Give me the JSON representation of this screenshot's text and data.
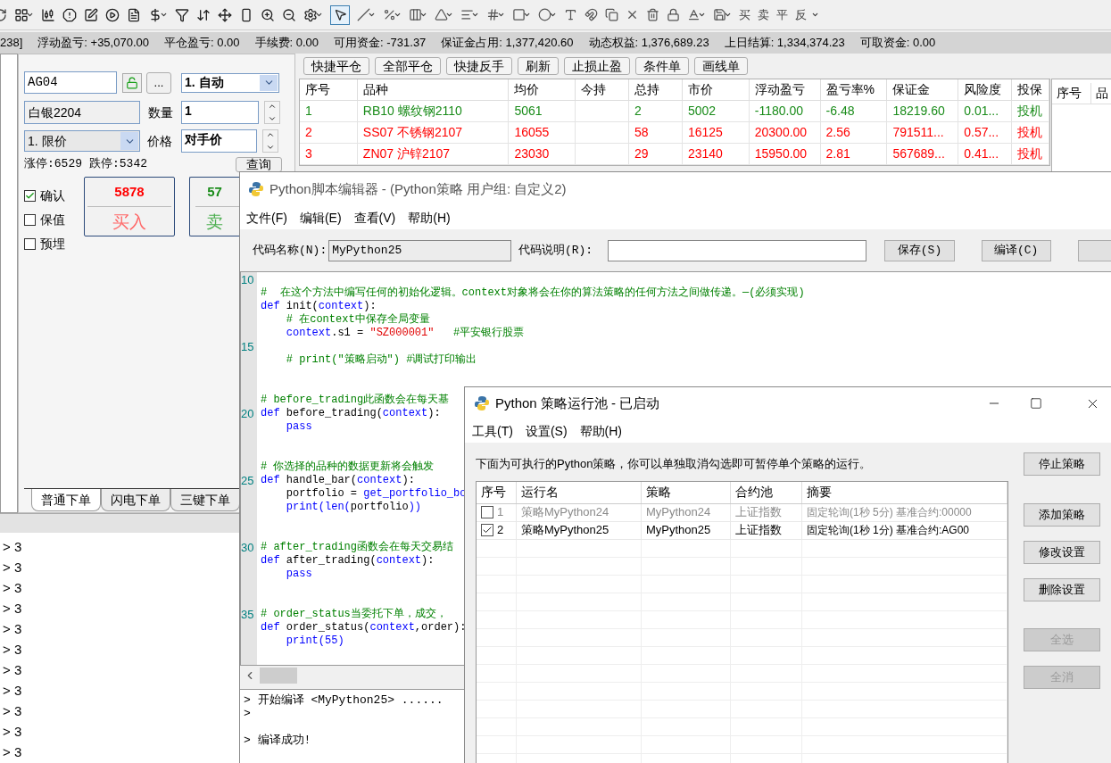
{
  "toolbar": {
    "pointer_tool_selected": true,
    "text_tools": [
      "买",
      "卖",
      "平",
      "反"
    ]
  },
  "status_bar": [
    "238]",
    "浮动盈亏: +35,070.00",
    "平仓盈亏: 0.00",
    "手续费: 0.00",
    "可用资金: -731.37",
    "保证金占用: 1,377,420.60",
    "动态权益: 1,376,689.23",
    "上日结算: 1,334,374.23",
    "可取资金: 0.00"
  ],
  "order_form": {
    "code": "AG04",
    "more_button": "...",
    "mode": "1. 自动",
    "contract": "白银2204",
    "quantity_label": "数量",
    "quantity": "1",
    "price_type": "1. 限价",
    "price_label": "价格",
    "price": "对手价",
    "limit_up": "涨停:6529",
    "limit_down": "跌停:5342",
    "query_button": "查询",
    "options": [
      {
        "label": "确认",
        "checked": true
      },
      {
        "label": "保值",
        "checked": false
      },
      {
        "label": "预埋",
        "checked": false
      }
    ],
    "buy": {
      "price": "5878",
      "label": "买入"
    },
    "sell": {
      "price": "57",
      "label": "卖"
    },
    "tabs": [
      {
        "label": "普通下单",
        "selected": true
      },
      {
        "label": "闪电下单",
        "selected": false
      },
      {
        "label": "三键下单",
        "selected": false
      }
    ]
  },
  "log": {
    "lines": [
      "> 3",
      "> 3",
      "> 3",
      "> 3",
      "> 3",
      "> 3",
      "> 3",
      "> 3",
      "> 3",
      "> 3",
      "> 3"
    ]
  },
  "positions": {
    "buttons": [
      "快捷平仓",
      "全部平仓",
      "快捷反手",
      "刷新",
      "止损止盈",
      "条件单",
      "画线单"
    ],
    "columns": [
      "序号",
      "品种",
      "均价",
      "今持",
      "总持",
      "市价",
      "浮动盈亏",
      "盈亏率%",
      "保证金",
      "风险度",
      "投保"
    ],
    "rows": [
      {
        "color": "#1a8c1a",
        "cells": [
          "1",
          "RB10 螺纹钢2110",
          "5061",
          null,
          "2",
          "5002",
          "-1180.00",
          "-6.48",
          "18219.60",
          "0.01...",
          "投机"
        ]
      },
      {
        "color": "#ff0000",
        "cells": [
          "2",
          "SS07 不锈钢2107",
          "16055",
          null,
          "58",
          "16125",
          "20300.00",
          "2.56",
          "791511...",
          "0.57...",
          "投机"
        ]
      },
      {
        "color": "#ff0000",
        "cells": [
          "3",
          "ZN07 沪锌2107",
          "23030",
          null,
          "29",
          "23140",
          "15950.00",
          "2.81",
          "567689...",
          "0.41...",
          "投机"
        ]
      }
    ]
  },
  "side_table": {
    "columns": [
      "序号",
      "品"
    ]
  },
  "editor": {
    "title": "Python脚本编辑器 - (Python策略 用户组: 自定义2)",
    "menu": [
      "文件(F)",
      "编辑(E)",
      "查看(V)",
      "帮助(H)"
    ],
    "name_label": "代码名称(N):",
    "name_value": "MyPython25",
    "desc_label": "代码说明(R):",
    "buttons": [
      "保存(S)",
      "编译(C)"
    ],
    "code": [
      {
        "kind": "blank",
        "number": "10"
      },
      {
        "kind": "code",
        "tokens": [
          {
            "t": "#  在这个方法中编写任何的初始化逻辑。context对象将会在你的算法策略的任何方法之间做传递。—(必须实现)",
            "kind": "comment"
          }
        ]
      },
      {
        "kind": "code",
        "tokens": [
          {
            "t": "def",
            "kind": "keyword"
          },
          {
            "t": " init(",
            "kind": "plain"
          },
          {
            "t": "context",
            "kind": "keyword"
          },
          {
            "t": "):",
            "kind": "plain"
          }
        ]
      },
      {
        "kind": "code",
        "tokens": [
          {
            "t": "    # 在context中保存全局变量",
            "kind": "comment"
          }
        ]
      },
      {
        "kind": "code",
        "tokens": [
          {
            "t": "    context",
            "kind": "keyword"
          },
          {
            "t": ".s1 = ",
            "kind": "plain"
          },
          {
            "t": "\"SZ000001\"",
            "kind": "string"
          },
          {
            "t": "   #平安银行股票",
            "kind": "comment"
          }
        ]
      },
      {
        "kind": "blank",
        "number": "15"
      },
      {
        "kind": "code",
        "tokens": [
          {
            "t": "    # print(\"策略启动\") #调试打印输出",
            "kind": "comment"
          }
        ]
      },
      {
        "kind": "blank"
      },
      {
        "kind": "blank"
      },
      {
        "kind": "code",
        "tokens": [
          {
            "t": "# before_trading此函数会在每天基",
            "kind": "comment"
          }
        ]
      },
      {
        "kind": "code",
        "number": "20",
        "tokens": [
          {
            "t": "def",
            "kind": "keyword"
          },
          {
            "t": " before_trading(",
            "kind": "plain"
          },
          {
            "t": "context",
            "kind": "keyword"
          },
          {
            "t": "):",
            "kind": "plain"
          }
        ]
      },
      {
        "kind": "code",
        "tokens": [
          {
            "t": "    pass",
            "kind": "keyword"
          }
        ]
      },
      {
        "kind": "blank"
      },
      {
        "kind": "blank"
      },
      {
        "kind": "code",
        "tokens": [
          {
            "t": "# 你选择的品种的数据更新将会触发",
            "kind": "comment"
          }
        ]
      },
      {
        "kind": "code",
        "number": "25",
        "tokens": [
          {
            "t": "def",
            "kind": "keyword"
          },
          {
            "t": " handle_bar(",
            "kind": "plain"
          },
          {
            "t": "context",
            "kind": "keyword"
          },
          {
            "t": "):",
            "kind": "plain"
          }
        ]
      },
      {
        "kind": "code",
        "tokens": [
          {
            "t": "    portfolio = ",
            "kind": "plain"
          },
          {
            "t": "get_portfolio_bo",
            "kind": "keyword"
          }
        ]
      },
      {
        "kind": "code",
        "tokens": [
          {
            "t": "    print(len(",
            "kind": "keyword"
          },
          {
            "t": "portfolio",
            "kind": "plain"
          },
          {
            "t": "))",
            "kind": "keyword"
          }
        ]
      },
      {
        "kind": "blank"
      },
      {
        "kind": "blank"
      },
      {
        "kind": "code",
        "number": "30",
        "tokens": [
          {
            "t": "# after_trading函数会在每天交易结",
            "kind": "comment"
          }
        ]
      },
      {
        "kind": "code",
        "tokens": [
          {
            "t": "def",
            "kind": "keyword"
          },
          {
            "t": " after_trading(",
            "kind": "plain"
          },
          {
            "t": "context",
            "kind": "keyword"
          },
          {
            "t": "):",
            "kind": "plain"
          }
        ]
      },
      {
        "kind": "code",
        "tokens": [
          {
            "t": "    pass",
            "kind": "keyword"
          }
        ]
      },
      {
        "kind": "blank"
      },
      {
        "kind": "blank"
      },
      {
        "kind": "code",
        "number": "35",
        "tokens": [
          {
            "t": "# order_status当委托下单，成交，",
            "kind": "comment"
          }
        ]
      },
      {
        "kind": "code",
        "tokens": [
          {
            "t": "def",
            "kind": "keyword"
          },
          {
            "t": " order_status(",
            "kind": "plain"
          },
          {
            "t": "context",
            "kind": "keyword"
          },
          {
            "t": ",order):",
            "kind": "plain"
          }
        ]
      },
      {
        "kind": "code",
        "tokens": [
          {
            "t": "    print(55)",
            "kind": "keyword"
          }
        ]
      }
    ],
    "output": [
      {
        "kind": "text",
        "text": "> 开始编译 <MyPython25> ......"
      },
      {
        "kind": "text",
        "text": ">"
      },
      {
        "kind": "blank"
      },
      {
        "kind": "text",
        "text": "> 编译成功!"
      }
    ]
  },
  "pool": {
    "title": "Python 策略运行池 - 已启动",
    "menu": [
      "工具(T)",
      "设置(S)",
      "帮助(H)"
    ],
    "instruction": "下面为可执行的Python策略，你可以单独取消勾选即可暂停单个策略的运行。",
    "columns": [
      "序号",
      "运行名",
      "策略",
      "合约池",
      "摘要"
    ],
    "rows": [
      {
        "checked": false,
        "cells": [
          "1",
          "策略MyPython24",
          "MyPython24",
          "上证指数",
          "固定轮询(1秒 5分) 基准合约:00000"
        ]
      },
      {
        "checked": true,
        "cells": [
          "2",
          "策略MyPython25",
          "MyPython25",
          "上证指数",
          "固定轮询(1秒 1分) 基准合约:AG00"
        ]
      }
    ],
    "buttons": [
      {
        "label": "停止策略",
        "disabled": false
      },
      {
        "label": "添加策略",
        "disabled": false
      },
      {
        "label": "修改设置",
        "disabled": false
      },
      {
        "label": "删除设置",
        "disabled": false
      },
      {
        "label": "全选",
        "disabled": true
      },
      {
        "label": "全消",
        "disabled": true
      }
    ]
  }
}
